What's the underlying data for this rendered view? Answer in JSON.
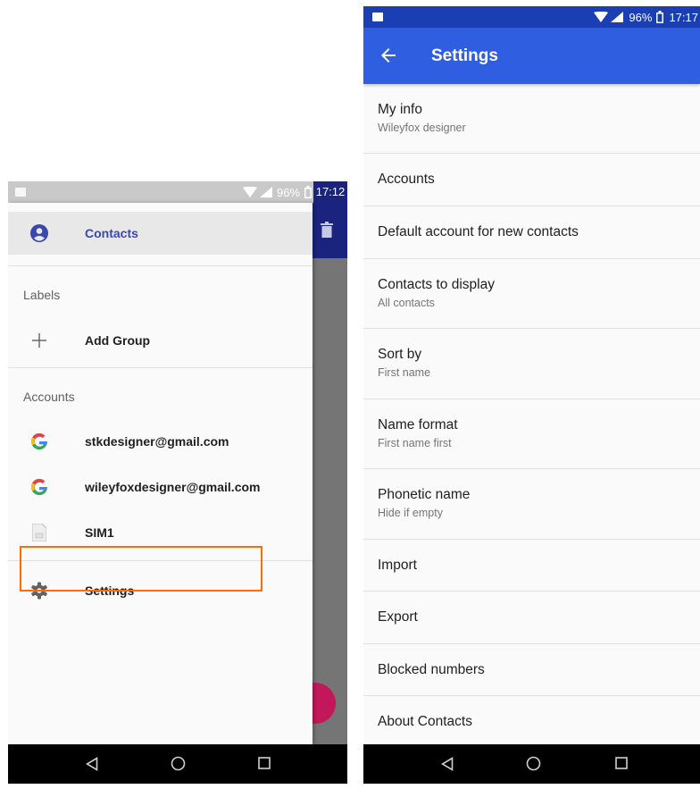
{
  "left_screen": {
    "status_bar": {
      "battery": "96%",
      "time": "17:12"
    },
    "drawer": {
      "contacts_label": "Contacts",
      "labels_header": "Labels",
      "add_group_label": "Add Group",
      "accounts_header": "Accounts",
      "accounts": [
        {
          "label": "stkdesigner@gmail.com",
          "icon": "google-icon"
        },
        {
          "label": "wileyfoxdesigner@gmail.com",
          "icon": "google-icon"
        },
        {
          "label": "SIM1",
          "icon": "sim-card-icon"
        }
      ],
      "settings_label": "Settings"
    },
    "highlight_color": "#ff6d00"
  },
  "right_screen": {
    "status_bar": {
      "battery": "96%",
      "time": "17:17"
    },
    "toolbar": {
      "title": "Settings"
    },
    "items": [
      {
        "title": "My info",
        "subtitle": "Wileyfox designer"
      },
      {
        "title": "Accounts"
      },
      {
        "title": "Default account for new contacts"
      },
      {
        "title": "Contacts to display",
        "subtitle": "All contacts"
      },
      {
        "title": "Sort by",
        "subtitle": "First name"
      },
      {
        "title": "Name format",
        "subtitle": "First name first"
      },
      {
        "title": "Phonetic name",
        "subtitle": "Hide if empty"
      },
      {
        "title": "Import"
      },
      {
        "title": "Export"
      },
      {
        "title": "Blocked numbers"
      },
      {
        "title": "About Contacts"
      }
    ]
  },
  "colors": {
    "toolbar_blue": "#2f5fe0",
    "status_blue": "#1a3fb3",
    "accent_indigo": "#3949ab",
    "fab_pink": "#c2185b"
  }
}
